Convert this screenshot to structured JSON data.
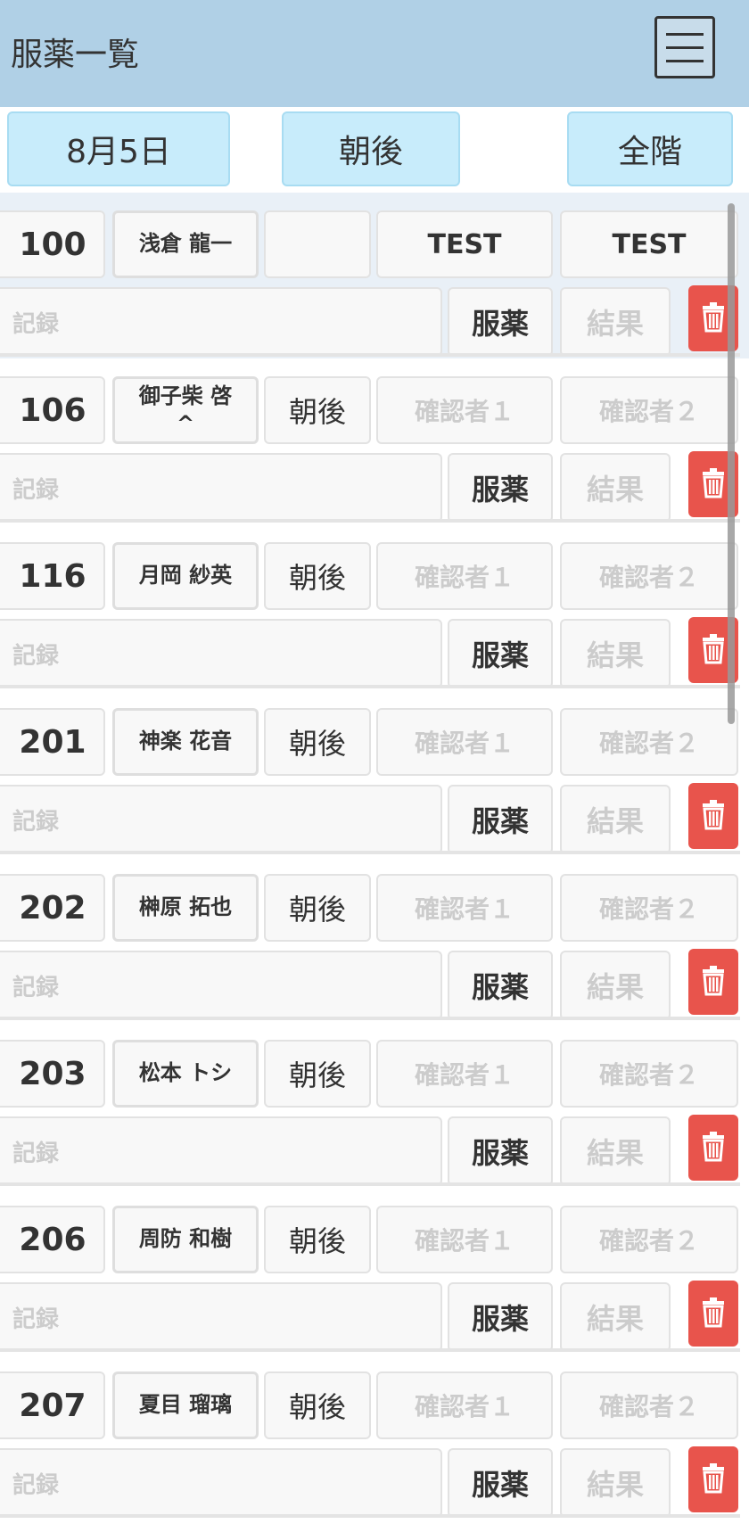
{
  "header": {
    "title": "服薬一覧",
    "menu_icon": "hamburger-menu-icon"
  },
  "filters": {
    "date": "8月5日",
    "timing": "朝後",
    "floor": "全階"
  },
  "placeholders": {
    "confirmer1": "確認者１",
    "confirmer2": "確認者２",
    "memo": "記録",
    "result": "結果"
  },
  "labels": {
    "take": "服薬"
  },
  "colors": {
    "header_bg": "#b0d0e6",
    "filter_bg": "#c8ecfb",
    "delete_bg": "#e8544c"
  },
  "records": [
    {
      "room": "100",
      "name": "浅倉 龍一",
      "timing": "",
      "confirmer1": "TEST",
      "confirmer2": "TEST"
    },
    {
      "room": "106",
      "name": "御子柴 啓\n^",
      "timing": "朝後",
      "confirmer1": "",
      "confirmer2": ""
    },
    {
      "room": "116",
      "name": "月岡 紗英",
      "timing": "朝後",
      "confirmer1": "",
      "confirmer2": ""
    },
    {
      "room": "201",
      "name": "神楽 花音",
      "timing": "朝後",
      "confirmer1": "",
      "confirmer2": ""
    },
    {
      "room": "202",
      "name": "榊原 拓也",
      "timing": "朝後",
      "confirmer1": "",
      "confirmer2": ""
    },
    {
      "room": "203",
      "name": "松本 トシ",
      "timing": "朝後",
      "confirmer1": "",
      "confirmer2": ""
    },
    {
      "room": "206",
      "name": "周防 和樹",
      "timing": "朝後",
      "confirmer1": "",
      "confirmer2": ""
    },
    {
      "room": "207",
      "name": "夏目 瑠璃",
      "timing": "朝後",
      "confirmer1": "",
      "confirmer2": ""
    }
  ]
}
